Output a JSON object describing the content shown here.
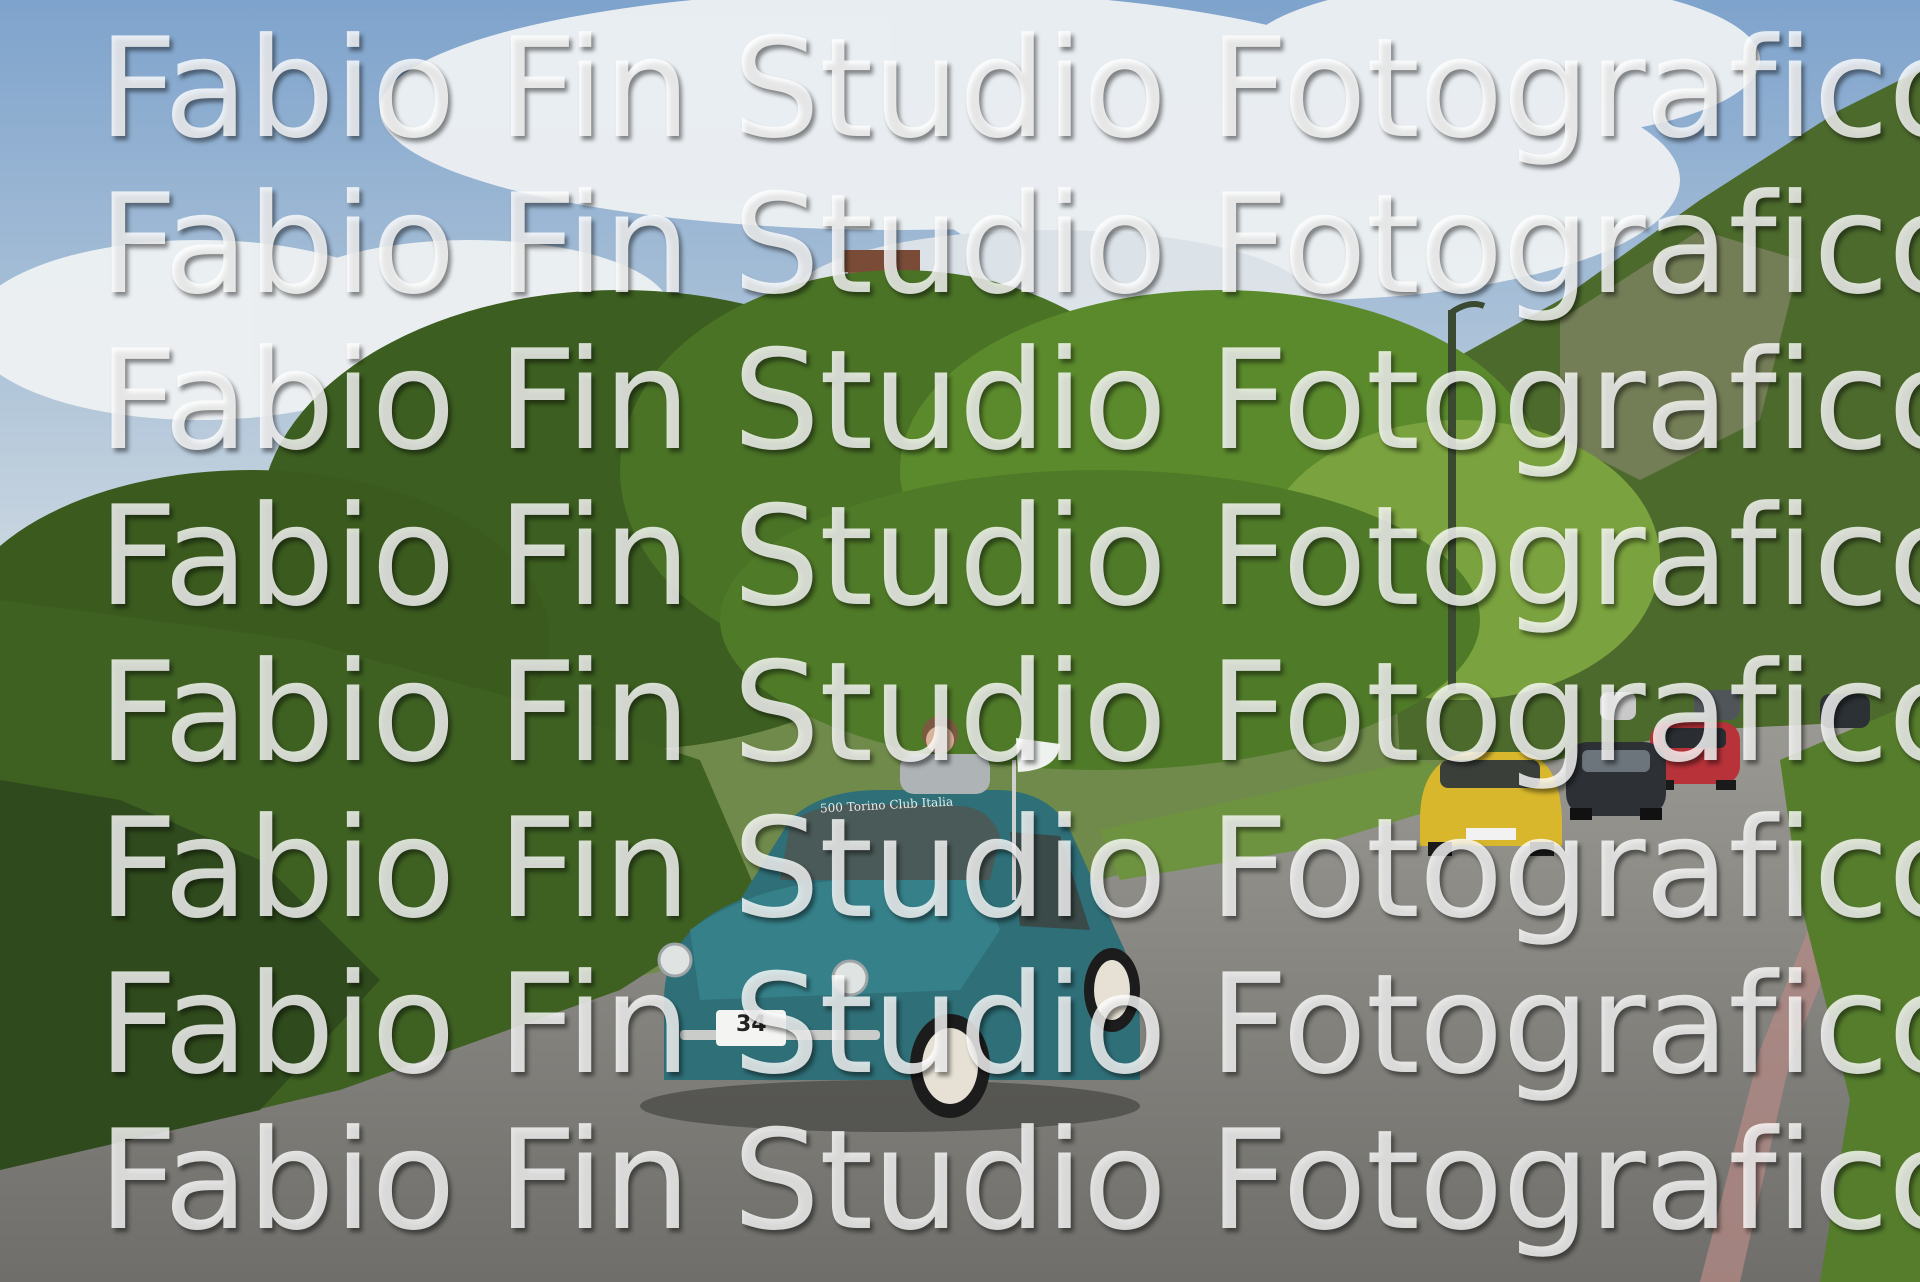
{
  "photo": {
    "watermark": "Fabio Fin Studio Fotografico",
    "windshield_banner": "500 Torino Club Italia",
    "race_number": "34"
  },
  "colors": {
    "sky": "#8fb0d4",
    "cloud": "#eef1f3",
    "foliage_dark": "#2f4a1c",
    "foliage_mid": "#4d7a2a",
    "foliage_light": "#86ad4a",
    "road": "#7d7c78",
    "lead_car": "#2f6f78",
    "yellow_car": "#d8b72c",
    "red_car": "#b8323a"
  }
}
